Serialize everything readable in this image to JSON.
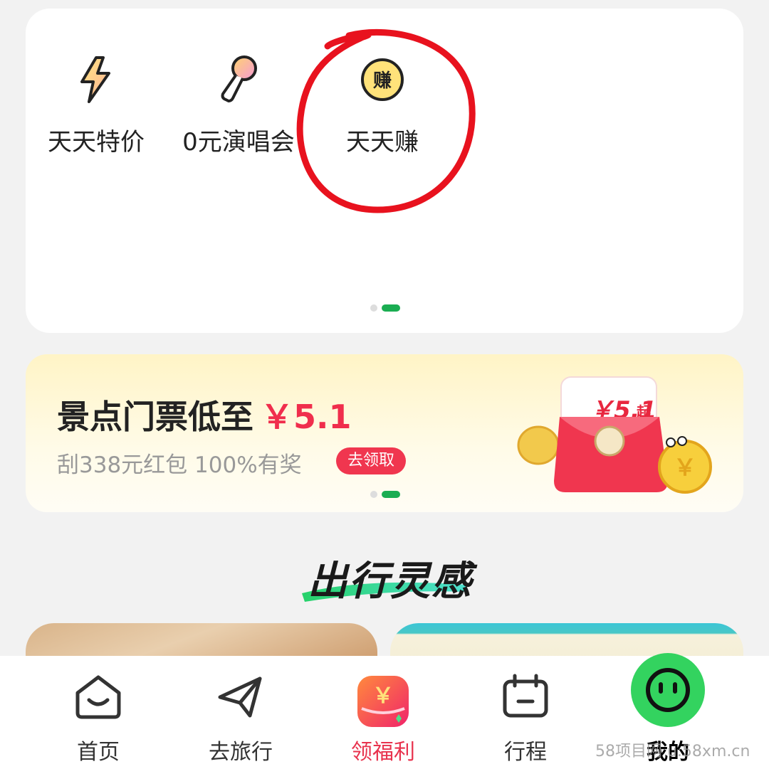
{
  "shortcuts": [
    {
      "label": "天天特价",
      "icon": "lightning-icon"
    },
    {
      "label": "0元演唱会",
      "icon": "microphone-icon"
    },
    {
      "label": "天天赚",
      "icon": "earn-coin-icon",
      "icon_text": "赚"
    }
  ],
  "banner": {
    "title": "景点门票低至",
    "price": "￥5.1",
    "subtitle": "刮338元红包 100%有奖",
    "cta": "去领取",
    "art_text": "￥5.1",
    "art_suffix": "起"
  },
  "section": {
    "title": "出行灵感"
  },
  "tabbar": {
    "items": [
      {
        "label": "首页",
        "icon": "home-icon"
      },
      {
        "label": "去旅行",
        "icon": "paper-plane-icon"
      },
      {
        "label": "领福利",
        "icon": "welfare-icon",
        "icon_text": "￥"
      },
      {
        "label": "行程",
        "icon": "calendar-icon"
      },
      {
        "label": "我的",
        "icon": "smiley-avatar-icon"
      }
    ]
  },
  "watermark": "58项目网 u.58xm.cn",
  "colors": {
    "accent_green": "#1aad52",
    "accent_red": "#f02e4c",
    "annotation_red": "#e8121e"
  }
}
